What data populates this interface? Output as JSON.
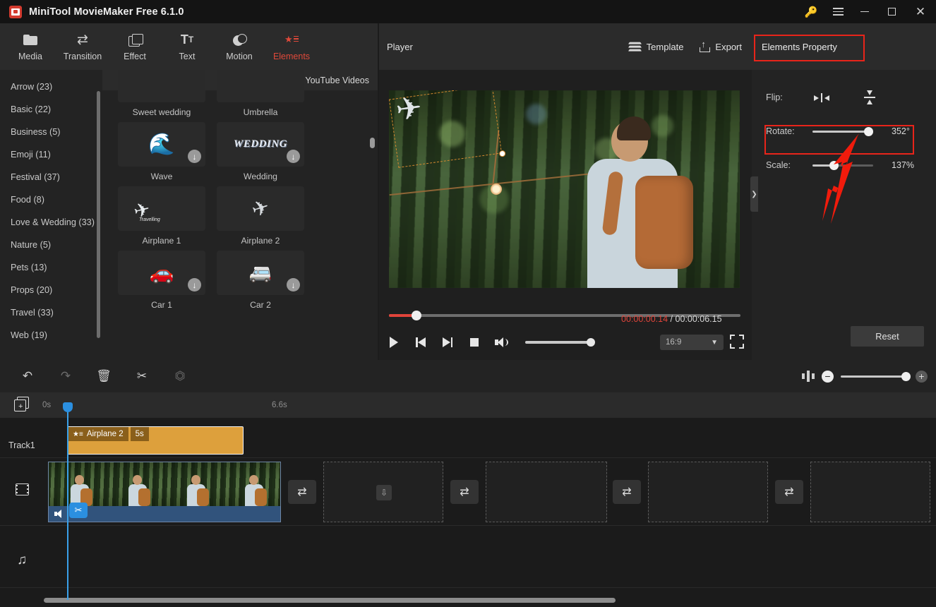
{
  "window": {
    "title": "MiniTool MovieMaker Free 6.1.0",
    "controls": {
      "key": "key-icon",
      "menu": "menu-icon",
      "minimize": "minimize-icon",
      "maximize": "maximize-icon",
      "close": "close-icon"
    }
  },
  "tabs": [
    {
      "label": "Media",
      "icon": "folder-icon",
      "active": false
    },
    {
      "label": "Transition",
      "icon": "transition-icon",
      "active": false
    },
    {
      "label": "Effect",
      "icon": "effect-icon",
      "active": false
    },
    {
      "label": "Text",
      "icon": "text-icon",
      "active": false
    },
    {
      "label": "Motion",
      "icon": "motion-icon",
      "active": false
    },
    {
      "label": "Elements",
      "icon": "elements-icon",
      "active": true
    }
  ],
  "categories": [
    {
      "label": "Arrow (23)"
    },
    {
      "label": "Basic (22)"
    },
    {
      "label": "Business (5)"
    },
    {
      "label": "Emoji (11)"
    },
    {
      "label": "Festival (37)"
    },
    {
      "label": "Food (8)"
    },
    {
      "label": "Love & Wedding (33)"
    },
    {
      "label": "Nature (5)"
    },
    {
      "label": "Pets (13)"
    },
    {
      "label": "Props (20)"
    },
    {
      "label": "Travel (33)"
    },
    {
      "label": "Web (19)"
    }
  ],
  "elements_panel": {
    "download_videos_label": "Download YouTube Videos",
    "rows": [
      [
        {
          "name": "Sweet wedding",
          "art": "",
          "download": false,
          "partial": true
        },
        {
          "name": "Umbrella",
          "art": "",
          "download": false,
          "partial": true
        }
      ],
      [
        {
          "name": "Wave",
          "art": "wave",
          "download": true
        },
        {
          "name": "Wedding",
          "art": "wedding",
          "download": true
        }
      ],
      [
        {
          "name": "Airplane 1",
          "art": "plane1",
          "download": false
        },
        {
          "name": "Airplane 2",
          "art": "plane2",
          "download": false
        }
      ],
      [
        {
          "name": "Car 1",
          "art": "car1",
          "download": true
        },
        {
          "name": "Car 2",
          "art": "car2",
          "download": true
        }
      ]
    ]
  },
  "player": {
    "title": "Player",
    "template_label": "Template",
    "export_label": "Export",
    "current_time": "00:00:00.14",
    "separator": "/",
    "total_time": "00:00:06.15",
    "aspect_ratio": "16:9",
    "progress_percent": 7,
    "volume_percent": 100,
    "controls": [
      "play-button",
      "previous-frame-button",
      "next-frame-button",
      "stop-button",
      "volume-button",
      "fullscreen-button"
    ]
  },
  "properties": {
    "title": "Elements Property",
    "flip_label": "Flip:",
    "flip_horizontal": "flip-horizontal-icon",
    "flip_vertical": "flip-vertical-icon",
    "rotate_label": "Rotate:",
    "rotate_value": "352°",
    "rotate_percent": 97,
    "scale_label": "Scale:",
    "scale_value": "137%",
    "scale_percent": 35,
    "reset_label": "Reset",
    "highlight_color": "#e8241a",
    "arrow_color": "#f11b0c"
  },
  "timeline": {
    "toolbar": [
      "undo-button",
      "redo-button",
      "delete-button",
      "split-button",
      "crop-button"
    ],
    "split_view_icon": "split-view-icon",
    "zoom_out": "−",
    "zoom_in": "+",
    "zoom_percent": 100,
    "ruler": {
      "start": "0s",
      "end": "6.6s"
    },
    "track_label": "Track1",
    "element_clip": {
      "name": "Airplane 2",
      "duration": "5s",
      "color": "#dda03c"
    },
    "video_clip": {
      "muted_icon": "speaker-icon",
      "cut_icon": "scissors-icon"
    },
    "add_media_icon": "add-media-icon",
    "video_track_icon": "film-icon",
    "audio_track_icon": "music-icon"
  }
}
